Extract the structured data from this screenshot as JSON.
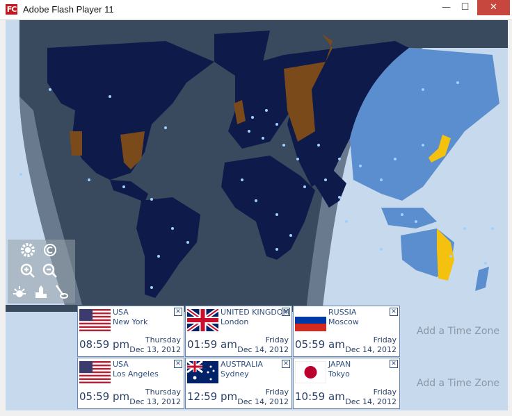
{
  "window": {
    "title": "Adobe Flash Player 11",
    "app_icon_text": "FC",
    "controls": {
      "minimize": "—",
      "maximize": "☐",
      "close": "✕"
    }
  },
  "colors": {
    "ocean_dark": "#3a4a5e",
    "land_dark": "#0d1a4a",
    "land_day": "#5b8ecf",
    "ocean_day": "#c7d9ec",
    "selected_region": "#7a4a1a",
    "highlight_region": "#f5c10f",
    "card_border": "#6a86ad",
    "label_text": "#2f4f7f"
  },
  "map_controls": [
    {
      "name": "settings-icon"
    },
    {
      "name": "copyright-icon"
    },
    {
      "name": "zoom-in-icon"
    },
    {
      "name": "zoom-out-icon"
    },
    {
      "name": "daylight-icon"
    },
    {
      "name": "city-icon"
    },
    {
      "name": "clear-icon"
    }
  ],
  "time_zones": [
    {
      "country": "USA",
      "city": "New York",
      "time": "08:59 pm",
      "day": "Thursday",
      "date": "Dec 13, 2012",
      "flag": "usa",
      "close": "✕"
    },
    {
      "country": "UNITED KINGDOM",
      "city": "London",
      "time": "01:59 am",
      "day": "Friday",
      "date": "Dec 14, 2012",
      "flag": "uk",
      "close": "✕"
    },
    {
      "country": "RUSSIA",
      "city": "Moscow",
      "time": "05:59 am",
      "day": "Friday",
      "date": "Dec 14, 2012",
      "flag": "russia",
      "close": "✕"
    },
    {
      "country": "USA",
      "city": "Los Angeles",
      "time": "05:59 pm",
      "day": "Thursday",
      "date": "Dec 13, 2012",
      "flag": "usa",
      "close": "✕"
    },
    {
      "country": "AUSTRALIA",
      "city": "Sydney",
      "time": "12:59 pm",
      "day": "Friday",
      "date": "Dec 14, 2012",
      "flag": "australia",
      "close": "✕"
    },
    {
      "country": "JAPAN",
      "city": "Tokyo",
      "time": "10:59 am",
      "day": "Friday",
      "date": "Dec 14, 2012",
      "flag": "japan",
      "close": "✕"
    }
  ],
  "add_time_zone": [
    "Add a Time Zone",
    "Add a Time Zone"
  ]
}
